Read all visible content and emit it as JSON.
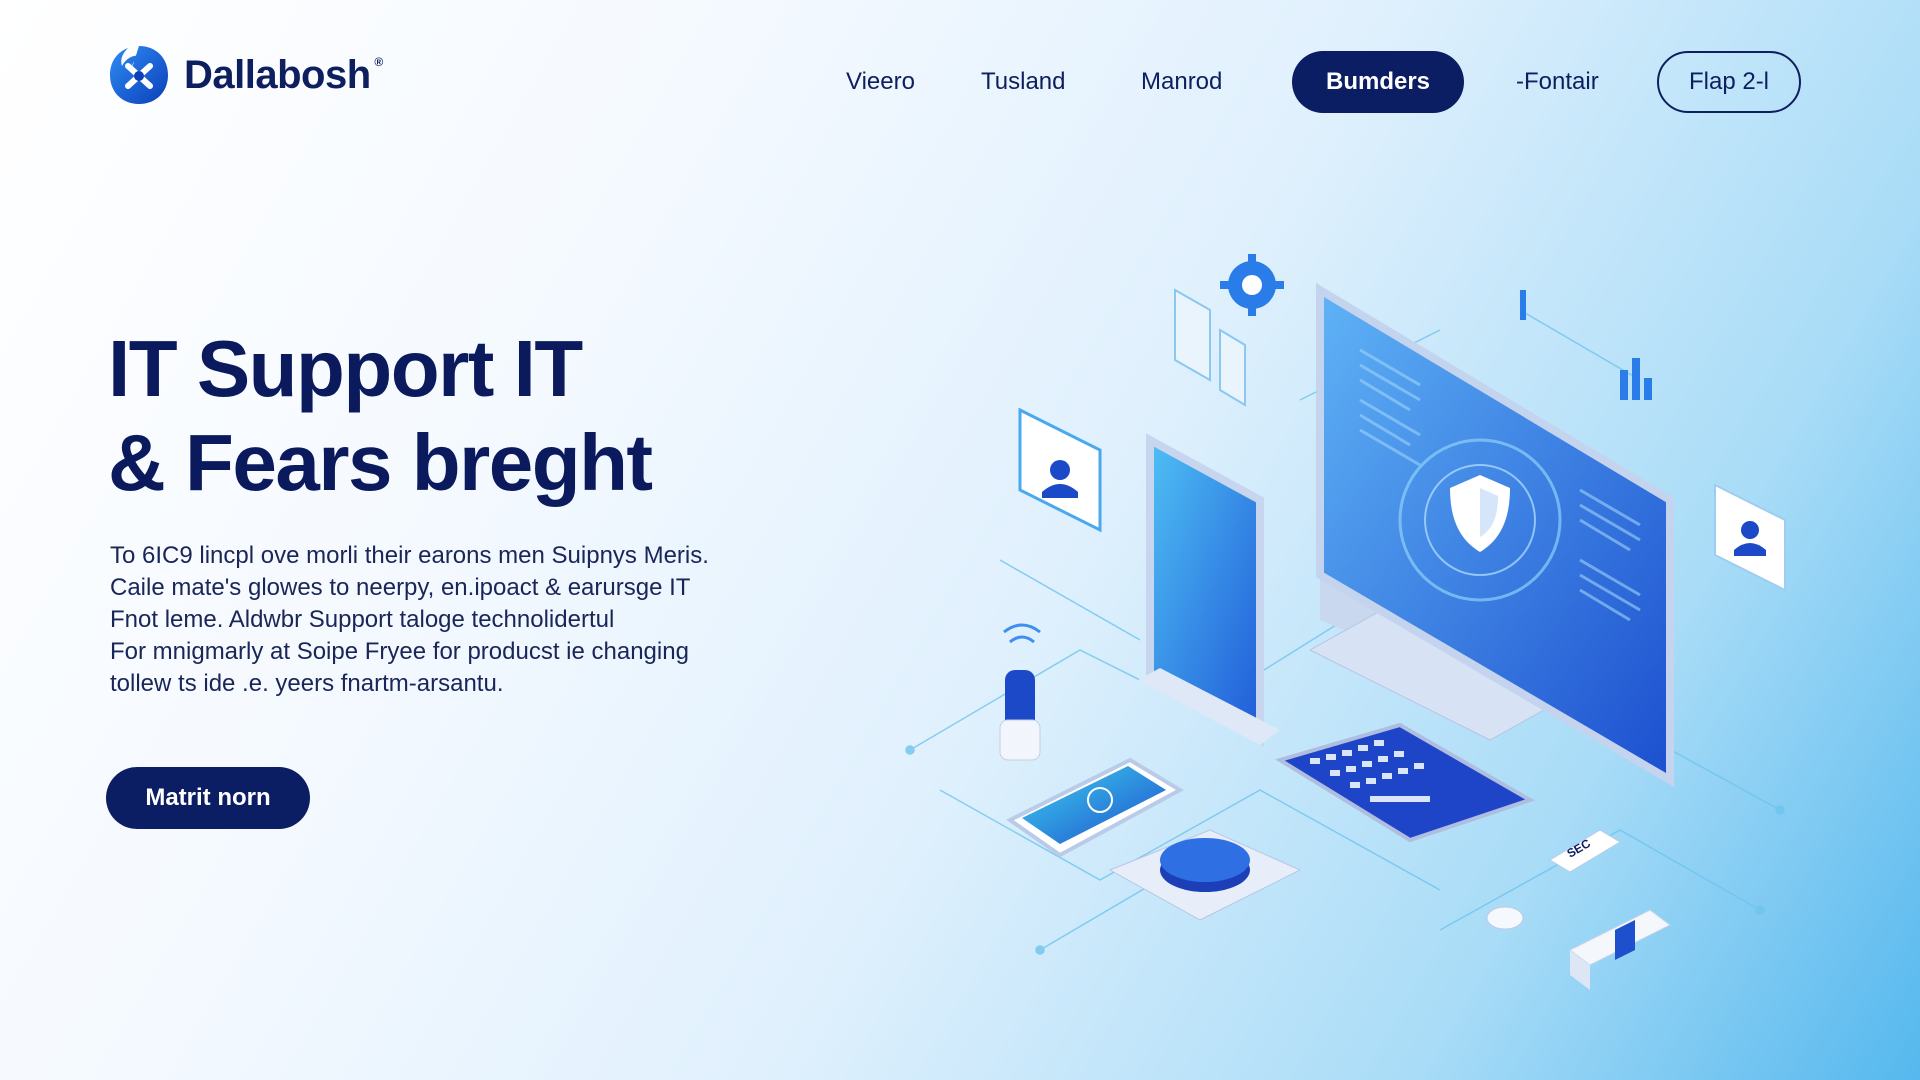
{
  "brand": {
    "name": "Dallabosh",
    "mark": "®",
    "logo_icon": "swirl-logo-icon",
    "primary_color": "#0b1d63",
    "accent_color": "#1f6fe0"
  },
  "nav": {
    "items": [
      {
        "label": "Vieero"
      },
      {
        "label": "Tusland"
      },
      {
        "label": "Manrod"
      },
      {
        "label": "Bumders",
        "active": true
      },
      {
        "label": "-Fontair"
      },
      {
        "label": "Flap 2-l",
        "outlined": true
      }
    ]
  },
  "hero": {
    "title_lines": [
      "IT Support IT",
      "& Fears breght"
    ],
    "body_lines": [
      "To 6IC9 lincpl ove morli their earons men Suipnys Meris.",
      "Caile mate's glowes to neerpy, en.ipoact & earursge IT",
      "Fnot leme. Aldwbr Support taloge technolidertul",
      "For mnigmarly at Soipe Fryee for  producst ie changing",
      "tollew ts ide .e. yeers fnartm-arsantu."
    ],
    "cta_label": "Matrit norn"
  },
  "illustration": {
    "description_icons": [
      "monitor-icon",
      "shield-icon",
      "tablet-icon",
      "phone-icon",
      "keyboard-icon",
      "mouse-icon",
      "gear-icon",
      "user-card-icon",
      "bar-chart-icon",
      "wifi-icon",
      "usb-icon",
      "router-icon"
    ],
    "badge_text": "SEC"
  }
}
